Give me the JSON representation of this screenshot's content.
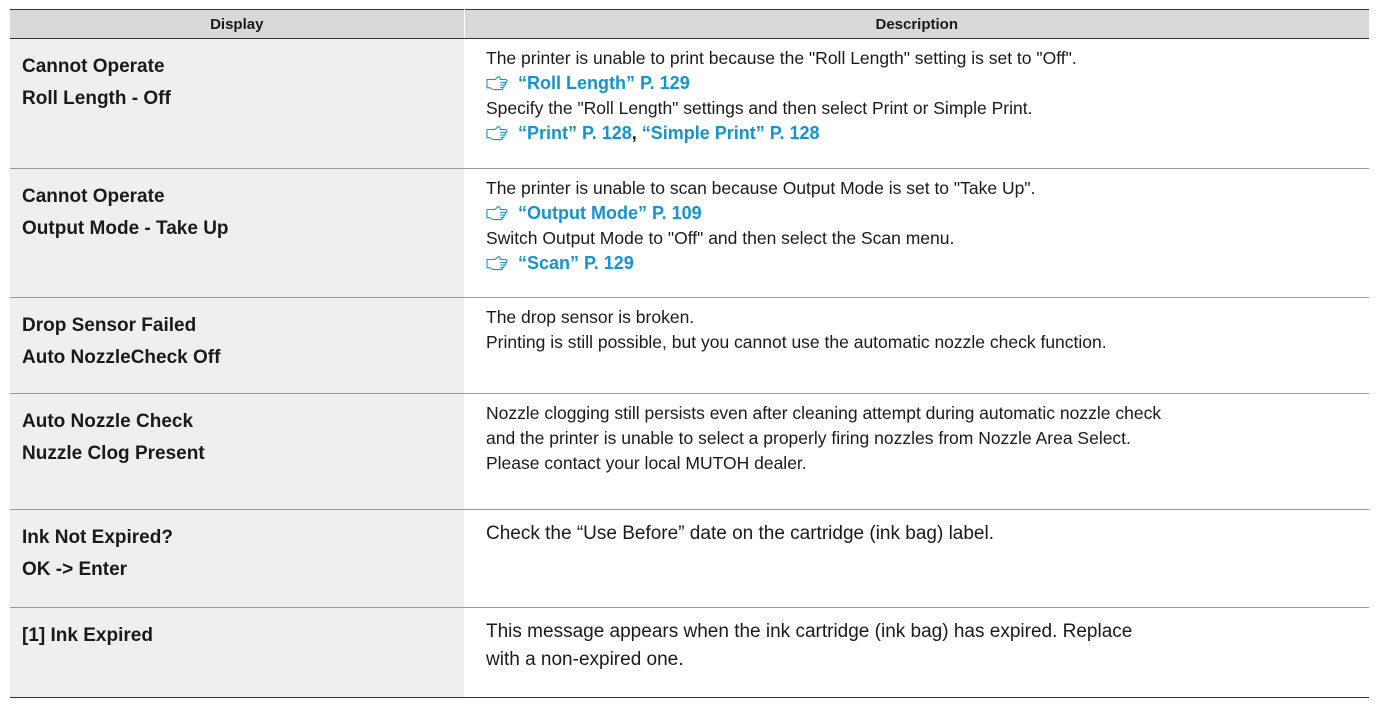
{
  "table": {
    "headers": {
      "display": "Display",
      "description": "Description"
    },
    "rows": [
      {
        "display": [
          "Cannot Operate",
          "Roll Length - Off"
        ],
        "desc": [
          {
            "type": "text",
            "text": "The printer is unable to print because the \"Roll Length\" setting is set to \"Off\"."
          },
          {
            "type": "ref",
            "refs": [
              {
                "label": "“Roll Length” P. 129"
              }
            ]
          },
          {
            "type": "text",
            "text": "Specify the \"Roll Length\" settings and then select Print or Simple Print."
          },
          {
            "type": "ref",
            "refs": [
              {
                "label": "“Print” P. 128"
              },
              {
                "label": "“Simple Print” P. 128"
              }
            ]
          }
        ]
      },
      {
        "display": [
          "Cannot Operate",
          "Output Mode - Take Up"
        ],
        "desc": [
          {
            "type": "text",
            "text": "The printer is unable to scan because Output Mode is set to \"Take Up\"."
          },
          {
            "type": "ref",
            "refs": [
              {
                "label": "“Output Mode” P. 109"
              }
            ]
          },
          {
            "type": "text",
            "text": "Switch Output Mode to \"Off\" and then select the Scan menu."
          },
          {
            "type": "ref",
            "refs": [
              {
                "label": "“Scan” P. 129"
              }
            ]
          }
        ]
      },
      {
        "display": [
          "Drop Sensor Failed",
          "Auto NozzleCheck Off"
        ],
        "desc": [
          {
            "type": "text",
            "text": "The drop sensor is broken."
          },
          {
            "type": "text",
            "text": "Printing is still possible, but you cannot use the automatic nozzle check function."
          }
        ]
      },
      {
        "display": [
          "Auto Nozzle Check",
          "Nuzzle Clog Present"
        ],
        "desc": [
          {
            "type": "text",
            "text": "Nozzle clogging still persists even after cleaning attempt during automatic nozzle check"
          },
          {
            "type": "text",
            "text": "and the printer is unable to select a properly firing nozzles from Nozzle Area Select."
          },
          {
            "type": "text",
            "text": "Please contact your local MUTOH dealer."
          }
        ]
      },
      {
        "display": [
          "Ink Not Expired?",
          "OK -> Enter"
        ],
        "large": true,
        "desc": [
          {
            "type": "text",
            "text": "Check the “Use Before” date on the cartridge (ink bag) label."
          }
        ]
      },
      {
        "display": [
          "[1] Ink Expired"
        ],
        "large": true,
        "desc": [
          {
            "type": "text",
            "text": "This message appears when the ink cartridge (ink bag) has expired. Replace"
          },
          {
            "type": "text",
            "text": "with a non-expired one."
          }
        ]
      }
    ]
  },
  "icons": {
    "reference": "pointing-hand-icon"
  },
  "colors": {
    "header_bg": "#d9d9d9",
    "display_bg": "#efefef",
    "link": "#1492d1"
  }
}
